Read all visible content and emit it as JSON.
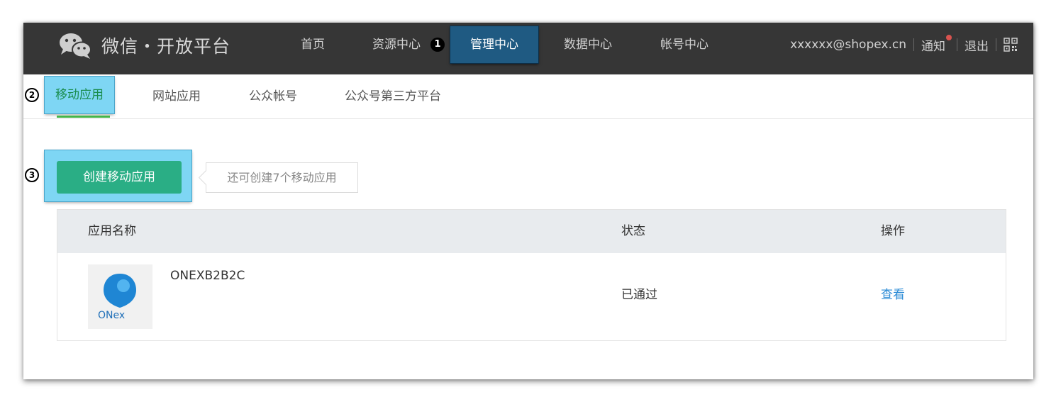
{
  "header": {
    "brand": "微信・开放平台",
    "nav": [
      "首页",
      "资源中心",
      "管理中心",
      "数据中心",
      "帐号中心"
    ],
    "active_nav": "管理中心",
    "user_email": "xxxxxx@shopex.cn",
    "notify_label": "通知",
    "logout_label": "退出"
  },
  "markers": {
    "one": "1",
    "two": "2",
    "three": "3"
  },
  "subnav": {
    "tabs": [
      "移动应用",
      "网站应用",
      "公众帐号",
      "公众号第三方平台"
    ]
  },
  "actions": {
    "create_label": "创建移动应用",
    "remaining_tip": "还可创建7个移动应用"
  },
  "table": {
    "headers": [
      "应用名称",
      "状态",
      "操作"
    ],
    "rows": [
      {
        "name": "ONEXB2B2C",
        "status": "已通过",
        "action": "查看",
        "icon_text": "ONex"
      }
    ]
  },
  "colors": {
    "topbar": "#363636",
    "active_nav": "#1f5a82",
    "highlight": "#7ed6f4",
    "primary_button": "#2aae85",
    "link": "#2d8cd6",
    "tab_underline": "#44b549"
  }
}
